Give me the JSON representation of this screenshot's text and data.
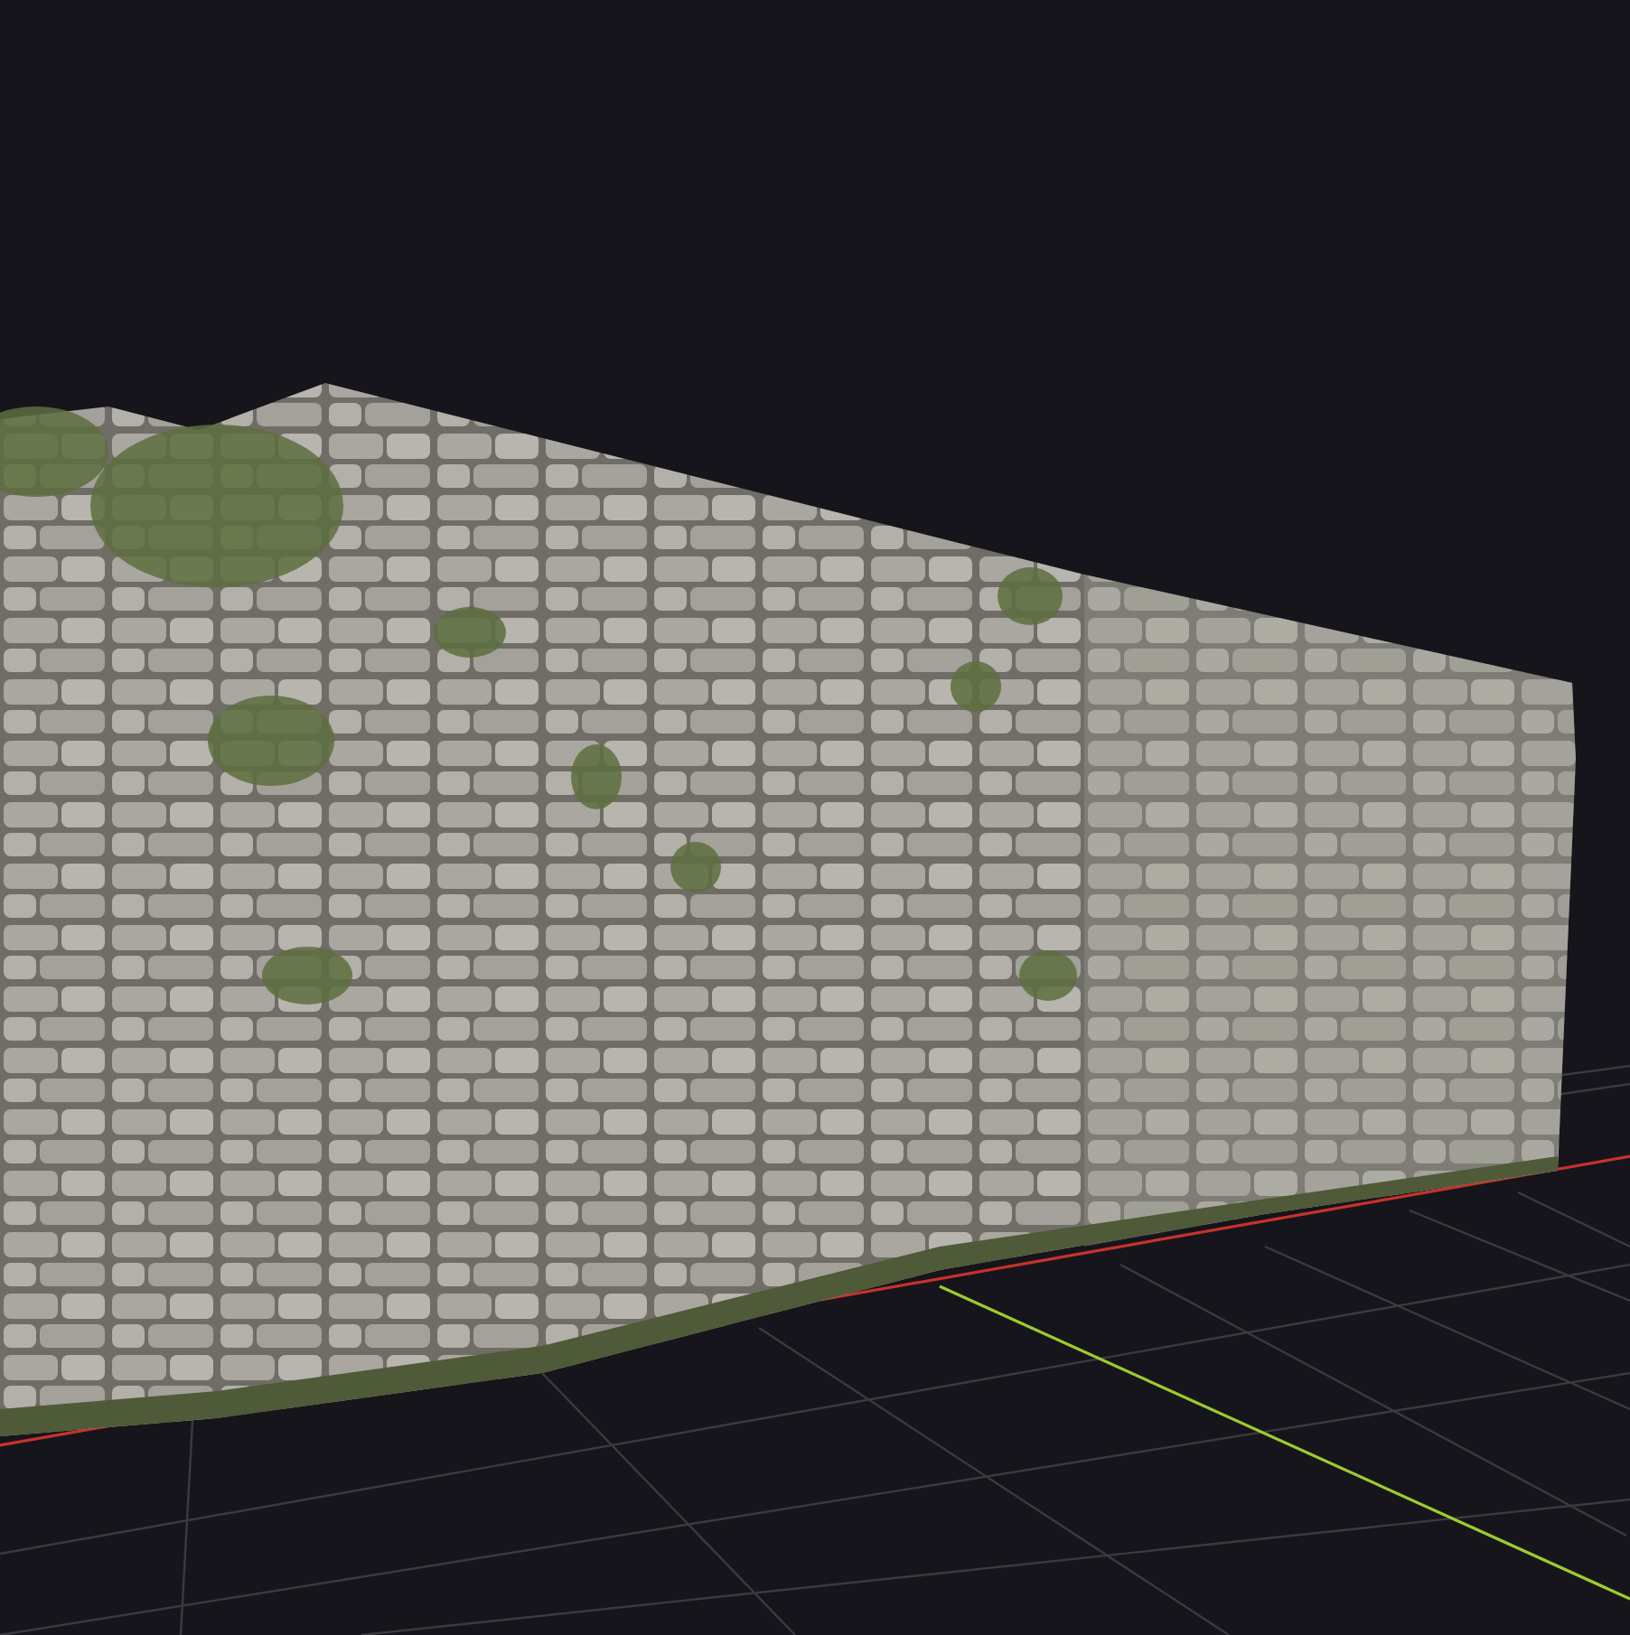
{
  "scene": {
    "grid_visible": true,
    "axes": [
      {
        "kind": "x",
        "color": "#c8322c"
      },
      {
        "kind": "y",
        "color": "#9ccc2e"
      }
    ]
  }
}
